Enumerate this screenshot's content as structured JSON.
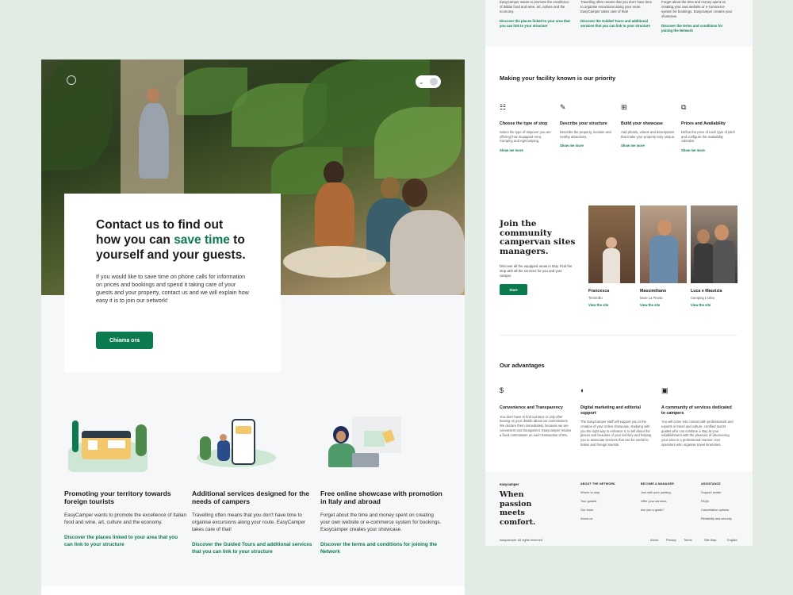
{
  "hero": {
    "title_part1": "Contact us to find out how you can ",
    "title_highlight": "save time",
    "title_part2": " to yourself and your guests.",
    "text": "If you would like to save time on phone calls for information on prices and bookings and spend it taking care of your guests and your property, contact us and we will explain how easy it is to join our network!",
    "button": "Chiama ora"
  },
  "features": [
    {
      "title": "Promoting your territory towards foreign tourists",
      "text": "EasyCamper wants to promote the excellence of Italian food and wine, art, culture and the economy.",
      "link": "Discover the places linked to your area that you can link to your structure",
      "icon": "camper-van-illustration"
    },
    {
      "title": "Additional services designed for the needs of campers",
      "text": "Travelling often means that you don't have time to organise excursions along your route. EasyCamper takes care of that!",
      "link": "Discover the Guided Tours and additional services that you can link to your structure",
      "icon": "phone-camper-illustration"
    },
    {
      "title": "Free online showcase with promotion in Italy and abroad",
      "text": "Forget about the time and money spent on creating your own website or e-commerce system for bookings. Easycamper creates your showcase.",
      "link": "Discover the terms and conditions for joining the Network",
      "icon": "laptop-woman-illustration"
    }
  ],
  "top_columns": [
    {
      "text": "EasyCamper wants to promote the excellence of Italian food and wine, art, culture and the economy.",
      "link": "Discover the places linked to your area that you can link to your structure"
    },
    {
      "text": "Travelling often means that you don't have time to organise excursions along your route. EasyCamper takes care of that!",
      "link": "Discover the Guided Tours and additional services that you can link to your structure"
    },
    {
      "text": "Forget about the time and money spent on creating your own website or e-commerce system for bookings. Easycamper creates your showcase.",
      "link": "Discover the terms and conditions for joining the Network"
    }
  ],
  "priority": {
    "heading": "Making your facility known is our priority",
    "steps": [
      {
        "icon": "list-icon",
        "glyph": "☷",
        "title": "Choose the type of stop",
        "text": "Select the type of stopover you are offering from Equipped Area, Camping and Agricamping.",
        "link": "Show me more"
      },
      {
        "icon": "edit-icon",
        "glyph": "✎",
        "title": "Describe your structure",
        "text": "Describe the property, location and nearby attractions.",
        "link": "Show me more"
      },
      {
        "icon": "grid-icon",
        "glyph": "⊞",
        "title": "Build your showcase",
        "text": "Add photos, videos and descriptions that make your property truly unique.",
        "link": "Show me more"
      },
      {
        "icon": "price-tag-icon",
        "glyph": "⧉",
        "title": "Prices and Availability",
        "text": "Define the price of each type of pitch and configure the availability calendar.",
        "link": "Show me more"
      }
    ]
  },
  "join": {
    "title": "Join the community campervan sites managers.",
    "text": "Discover all the equipped areas in Italy. Find the stop with all the services for you and your camper.",
    "button": "Start",
    "managers": [
      {
        "name": "Francesca",
        "location": "Terminillo",
        "link": "View the site",
        "tone": "#7a5a3e"
      },
      {
        "name": "Massimiliano",
        "location": "Mare La Pineta",
        "link": "View the site",
        "tone": "#a88a6c"
      },
      {
        "name": "Luca e Maurizia",
        "location": "Camping L'Ulivo",
        "link": "View the site",
        "tone": "#4a4038"
      }
    ]
  },
  "advantages": {
    "heading": "Our advantages",
    "items": [
      {
        "icon": "money-icon",
        "glyph": "$",
        "title": "Convenience and Transparency",
        "text": "You don't have to find out later or only after leaving us your details about our commissions. We declare them immediately, because we are convenient and transparent. Easycamper retains a fixed commission on each transaction of 6%."
      },
      {
        "icon": "marketing-icon",
        "glyph": "◐",
        "title": "Digital marketing and editorial support",
        "text": "The EasyCamper staff will support you in the creation of your online showcase, studying with you the right way to enhance it, to tell about the places and beauties of your territory and helping you to associate services that can be useful to Italian and foreign tourists."
      },
      {
        "icon": "camper-icon",
        "glyph": "▣",
        "title": "A community of services dedicated to campers",
        "text": "You will come into contact with professionals and experts in travel and culture, certified tourist guides who can combine a stay at your establishment with the pleasure of discovering your area in a professional manner; tour operators who organise travel itineraries."
      }
    ]
  },
  "footer": {
    "brand": "easycamper",
    "slogan": "When passion meets comfort.",
    "columns": [
      {
        "heading": "ABOUT THE NETWORK",
        "items": [
          "Where to stop",
          "Tour guided",
          "Our tours",
          "About us"
        ]
      },
      {
        "heading": "BECOME A MANAGER",
        "items": [
          "Join with your parking",
          "Offer your services",
          "Are you a guide?"
        ]
      },
      {
        "heading": "ASSISTANCE",
        "items": [
          "Support center",
          "FAQs",
          "Cancellation options",
          "Reliability and security"
        ]
      }
    ],
    "copyright": "easycamper. All rights reserved",
    "links": [
      "About",
      "Privacy",
      "Terms",
      "Site Map",
      "English"
    ]
  },
  "colors": {
    "accent": "#0b7a4f",
    "background": "#e3ebe5"
  }
}
